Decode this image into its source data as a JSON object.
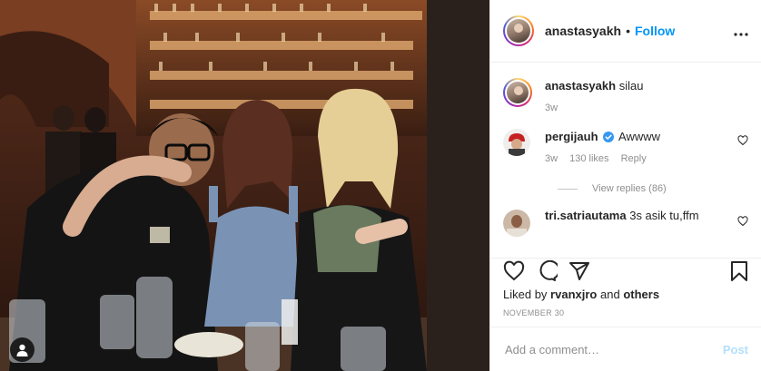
{
  "header": {
    "username": "anastasyakh",
    "separator": "•",
    "follow_label": "Follow",
    "more_icon": "more-options-icon"
  },
  "caption": {
    "username": "anastasyakh",
    "text": "silau",
    "time": "3w"
  },
  "comments": [
    {
      "username": "pergijauh",
      "verified": true,
      "text": "Awwww",
      "time": "3w",
      "likes": "130 likes",
      "reply_label": "Reply",
      "view_replies": "View replies (86)"
    },
    {
      "username": "tri.satriautama",
      "text": "3s asik tu,ffm"
    }
  ],
  "actions": {
    "liked_prefix": "Liked by",
    "liked_user": "rvanxjro",
    "liked_and": "and",
    "liked_others": "others",
    "date": "NOVEMBER 30"
  },
  "add_comment": {
    "placeholder": "Add a comment…",
    "post_label": "Post"
  },
  "colors": {
    "link_blue": "#0095f6",
    "post_disabled": "#b2dffc",
    "muted": "#8e8e8e"
  }
}
